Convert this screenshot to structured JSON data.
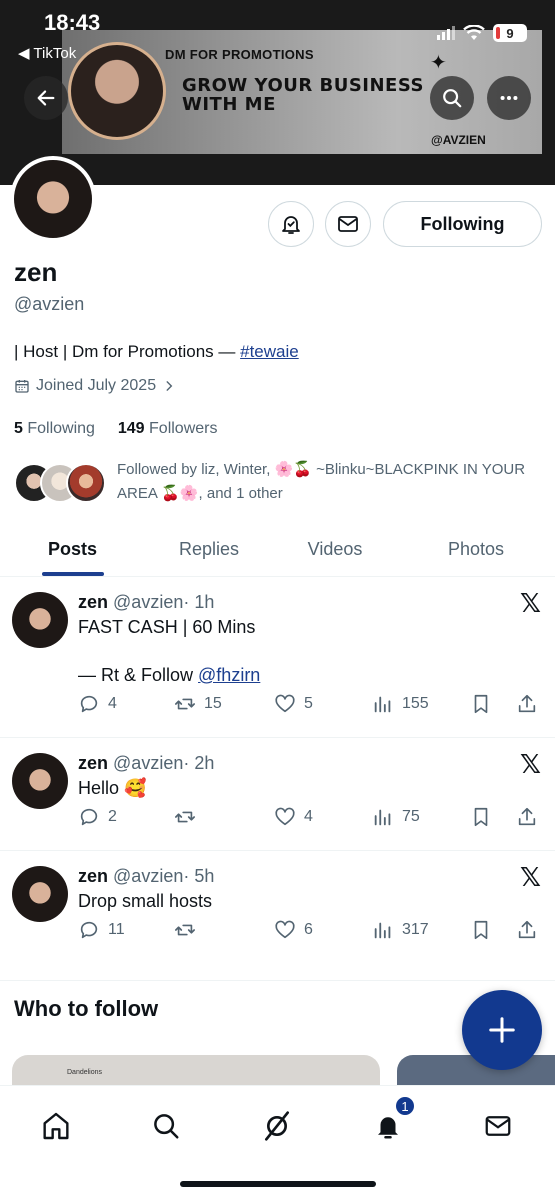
{
  "status_bar": {
    "time": "18:43",
    "back_app": "◀ TikTok",
    "battery": "9"
  },
  "banner": {
    "dm_text": "DM FOR PROMOTIONS",
    "headline": "GROW YOUR BUSINESS WITH ME",
    "handle": "@AVZIEN"
  },
  "profile": {
    "display_name": "zen",
    "handle": "@avzien",
    "bio_text": "| Host | Dm for Promotions — ",
    "bio_hashtag": "#tewaie",
    "joined": "Joined July 2025",
    "following_count": "5",
    "following_label": "Following",
    "followers_count": "149",
    "followers_label": "Followers",
    "followed_by": "Followed by liz, Winter, 🌸🍒 ~Blinku~BLACKPINK IN YOUR AREA 🍒🌸, and 1 other",
    "following_button": "Following"
  },
  "tabs": [
    {
      "label": "Posts",
      "active": true
    },
    {
      "label": "Replies",
      "active": false
    },
    {
      "label": "Videos",
      "active": false
    },
    {
      "label": "Photos",
      "active": false
    }
  ],
  "posts": [
    {
      "name": "zen",
      "handle": "@avzien",
      "time": "· 1h",
      "line1": "FAST CASH | 60 Mins",
      "line2_prefix": "— Rt & Follow ",
      "line2_link": "@fhzirn",
      "replies": "4",
      "reposts": "15",
      "likes": "5",
      "views": "155"
    },
    {
      "name": "zen",
      "handle": "@avzien",
      "time": "· 2h",
      "text": "Hello 🥰",
      "replies": "2",
      "reposts": "",
      "likes": "4",
      "views": "75"
    },
    {
      "name": "zen",
      "handle": "@avzien",
      "time": "· 5h",
      "text": "Drop small hosts",
      "replies": "11",
      "reposts": "",
      "likes": "6",
      "views": "317"
    }
  ],
  "who_to_follow": {
    "title": "Who to follow",
    "card_text": "Dandelions"
  },
  "notifications_badge": "1",
  "colors": {
    "accent": "#1d3f8f",
    "fab": "#12398f",
    "muted": "#536471"
  }
}
